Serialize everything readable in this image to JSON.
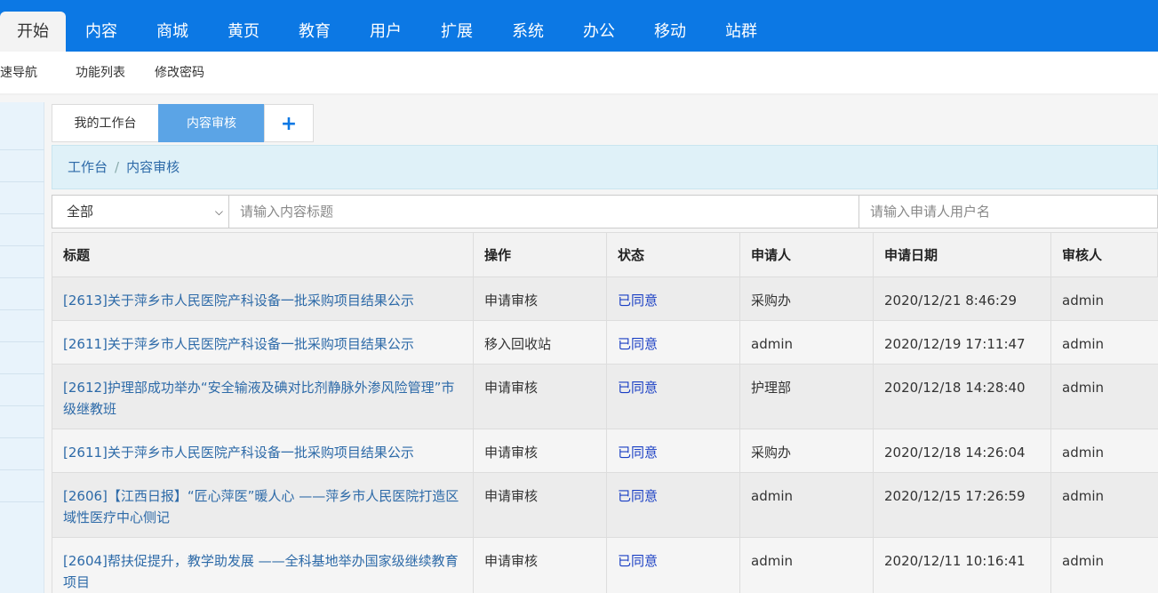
{
  "topnav": {
    "items": [
      "开始",
      "内容",
      "商城",
      "黄页",
      "教育",
      "用户",
      "扩展",
      "系统",
      "办公",
      "移动",
      "站群"
    ]
  },
  "subnav": {
    "items": [
      "快速导航",
      "功能列表",
      "修改密码"
    ]
  },
  "tabs": {
    "workbench": "我的工作台",
    "content_review": "内容审核",
    "add": "+"
  },
  "breadcrumb": {
    "root": "工作台",
    "separator": "/",
    "current": "内容审核"
  },
  "filters": {
    "category_selected": "全部",
    "title_placeholder": "请输入内容标题",
    "applicant_placeholder": "请输入申请人用户名"
  },
  "table": {
    "headers": [
      "标题",
      "操作",
      "状态",
      "申请人",
      "申请日期",
      "审核人"
    ],
    "rows": [
      {
        "title": "[2613]关于萍乡市人民医院产科设备一批采购项目结果公示",
        "action": "申请审核",
        "status": "已同意",
        "applicant": "采购办",
        "date": "2020/12/21 8:46:29",
        "reviewer": "admin"
      },
      {
        "title": "[2611]关于萍乡市人民医院产科设备一批采购项目结果公示",
        "action": "移入回收站",
        "status": "已同意",
        "applicant": "admin",
        "date": "2020/12/19 17:11:47",
        "reviewer": "admin"
      },
      {
        "title": "[2612]护理部成功举办“安全输液及碘对比剂静脉外渗风险管理”市级继教班",
        "action": "申请审核",
        "status": "已同意",
        "applicant": "护理部",
        "date": "2020/12/18 14:28:40",
        "reviewer": "admin"
      },
      {
        "title": "[2611]关于萍乡市人民医院产科设备一批采购项目结果公示",
        "action": "申请审核",
        "status": "已同意",
        "applicant": "采购办",
        "date": "2020/12/18 14:26:04",
        "reviewer": "admin"
      },
      {
        "title": "[2606]【江西日报】“匠心萍医”暖人心 ——萍乡市人民医院打造区域性医疗中心侧记",
        "action": "申请审核",
        "status": "已同意",
        "applicant": "admin",
        "date": "2020/12/15 17:26:59",
        "reviewer": "admin"
      },
      {
        "title": "[2604]帮扶促提升，教学助发展 ——全科基地举办国家级继续教育项目",
        "action": "申请审核",
        "status": "已同意",
        "applicant": "admin",
        "date": "2020/12/11 10:16:41",
        "reviewer": "admin"
      }
    ]
  },
  "colors": {
    "nav_bg": "#0c78e4",
    "active_tab": "#5ba4e6",
    "link": "#2d6aa8",
    "status": "#1a3fc4"
  }
}
